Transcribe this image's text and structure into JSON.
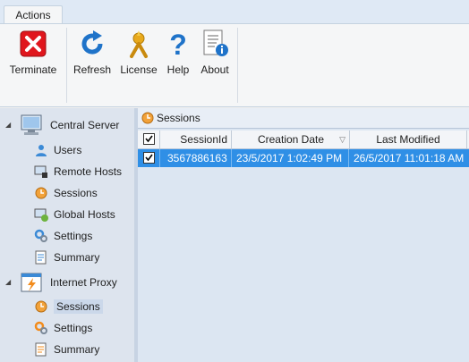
{
  "ribbon": {
    "tab_label": "Actions",
    "buttons": [
      {
        "label": "Terminate",
        "icon": "terminate-icon"
      },
      {
        "label": "Refresh",
        "icon": "refresh-icon"
      },
      {
        "label": "License",
        "icon": "license-icon"
      },
      {
        "label": "Help",
        "icon": "help-icon"
      },
      {
        "label": "About",
        "icon": "about-icon"
      }
    ]
  },
  "tree": {
    "central_server": {
      "label": "Central Server",
      "items": [
        "Users",
        "Remote Hosts",
        "Sessions",
        "Global Hosts",
        "Settings",
        "Summary"
      ]
    },
    "internet_proxy": {
      "label": "Internet Proxy",
      "items": [
        "Sessions",
        "Settings",
        "Summary"
      ],
      "selected": "Sessions"
    }
  },
  "panel": {
    "title": "Sessions",
    "columns": [
      "SessionId",
      "Creation Date",
      "Last Modified"
    ],
    "rows": [
      {
        "checked": true,
        "session_id": "3567886163",
        "creation_date": "23/5/2017 1:02:49 PM",
        "last_modified": "26/5/2017 11:01:18 AM"
      }
    ]
  },
  "colors": {
    "selection": "#2f8fe6",
    "tree_bg": "#dde4ee",
    "ribbon_bg": "#f5f6f7"
  }
}
